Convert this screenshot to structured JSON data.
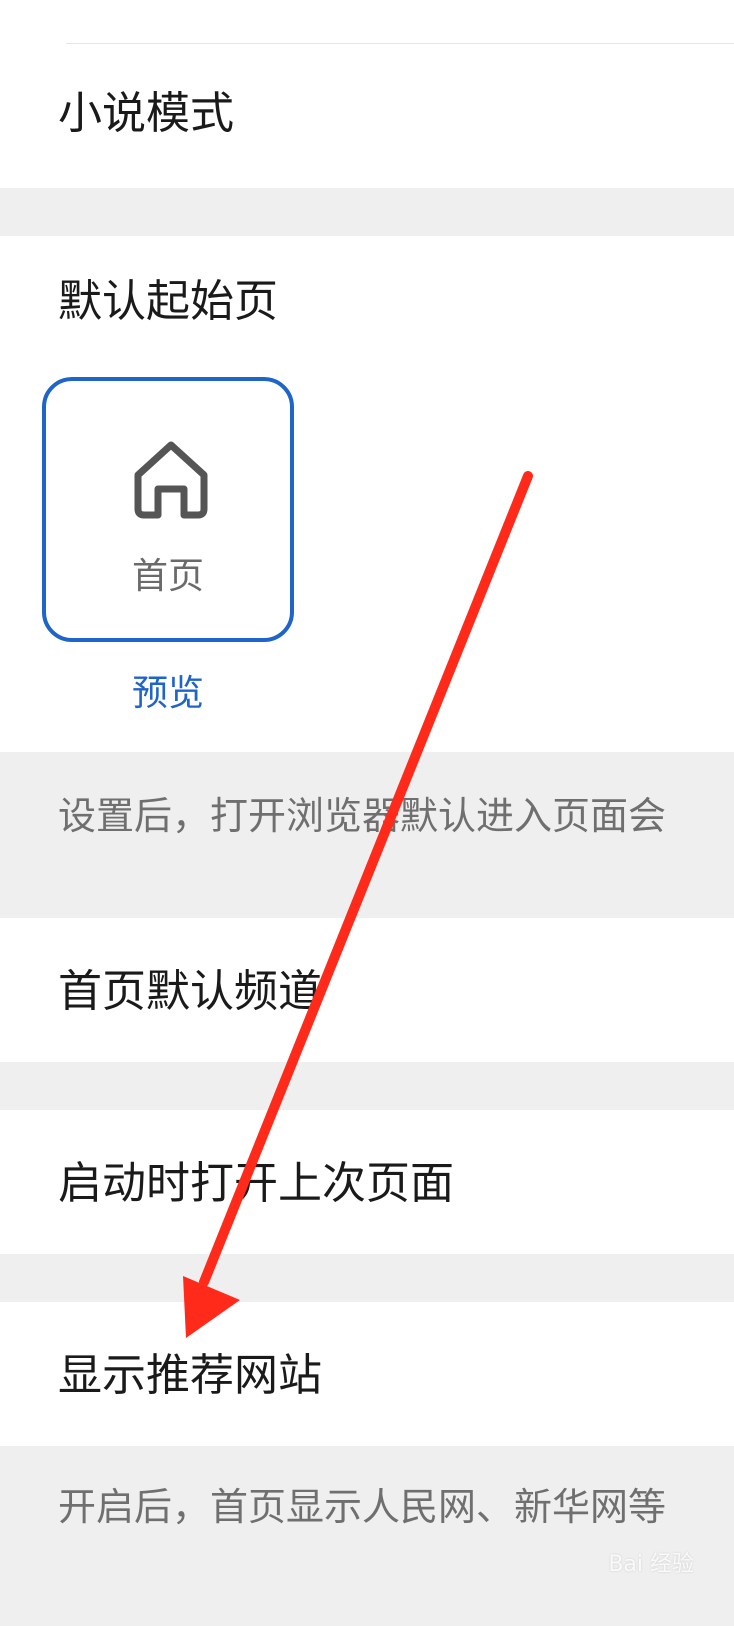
{
  "rows": {
    "novel_mode": "小说模式",
    "default_start_page": "默认起始页",
    "home_default_channel": "首页默认频道",
    "open_last_page_on_start": "启动时打开上次页面",
    "show_recommended_sites": "显示推荐网站"
  },
  "start_page_card": {
    "label": "首页",
    "icon": "home-icon",
    "preview_label": "预览",
    "accent_color": "#1f64c8"
  },
  "hints": {
    "start_page_hint": "设置后，打开浏览器默认进入页面会",
    "recommended_sites_hint": "开启后，首页显示人民网、新华网等"
  },
  "watermark": {
    "text": "Bai 经验"
  },
  "annotation": {
    "arrow_color": "#ff2a1a"
  }
}
